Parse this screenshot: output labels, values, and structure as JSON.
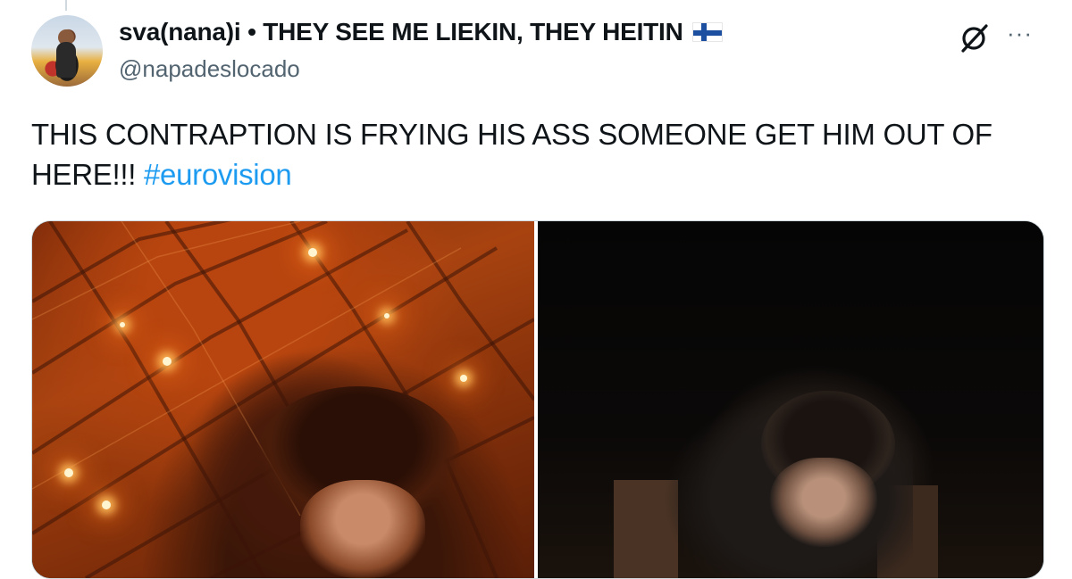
{
  "tweet": {
    "author": {
      "display_name": "sva(nana)i • THEY SEE ME LIEKIN, THEY HEITIN",
      "flag_icon": "finland-flag-icon",
      "handle": "@napadeslocado"
    },
    "text": "THIS CONTRAPTION IS FRYING HIS ASS SOMEONE GET HIM OUT OF HERE!!!",
    "hashtag": "#eurovision",
    "icons": {
      "grok": "grok-icon",
      "more": "more-options-icon",
      "more_glyph": "···"
    }
  },
  "colors": {
    "text": "#0f1419",
    "secondary": "#536471",
    "link": "#1d9bf0",
    "border": "#cfd9de"
  }
}
